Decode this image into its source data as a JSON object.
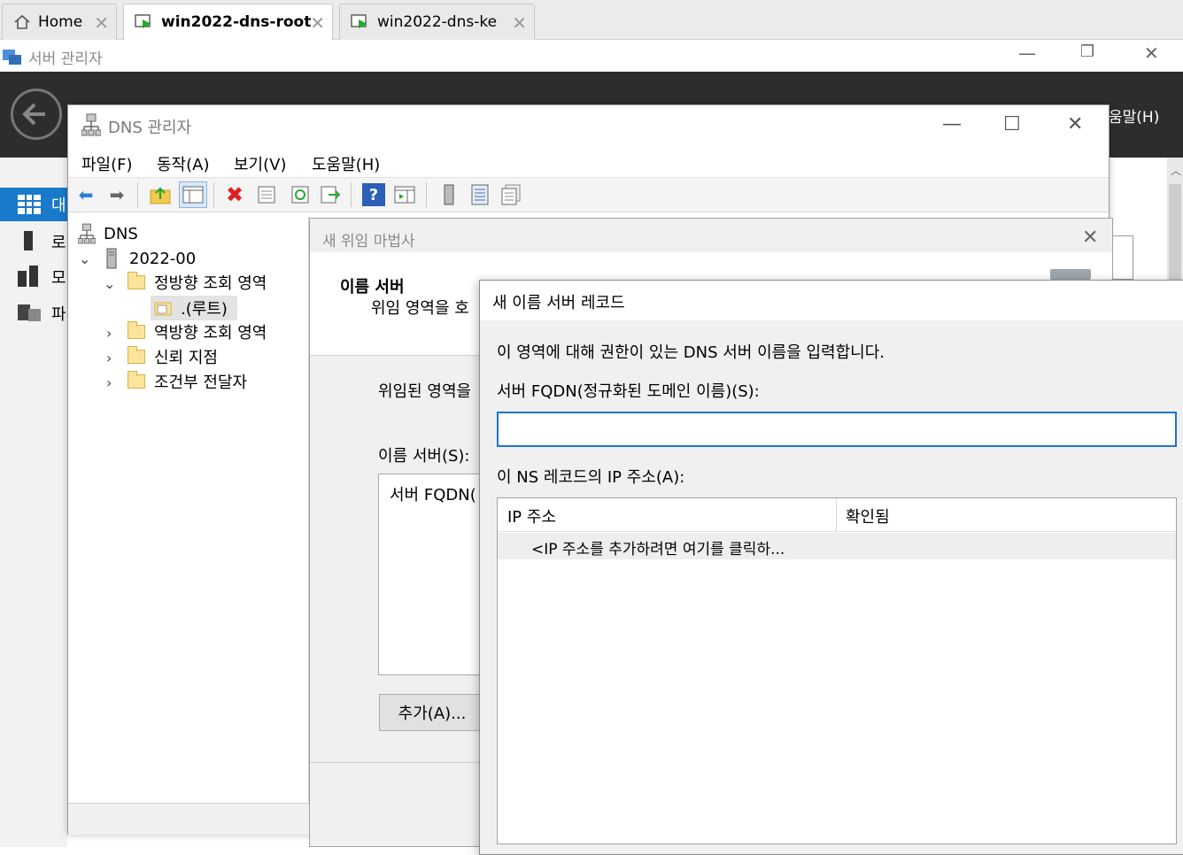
{
  "browser": {
    "tabs": [
      {
        "label": "Home",
        "icon": "home-icon",
        "active": false
      },
      {
        "label": "win2022-dns-root",
        "icon": "vm-icon",
        "active": true
      },
      {
        "label": "win2022-dns-ke",
        "icon": "vm-icon",
        "active": false
      }
    ]
  },
  "server_manager": {
    "title": "서버 관리자",
    "help_menu": "움말(H)",
    "sidebar": [
      {
        "label": "대",
        "icon": "dashboard-icon"
      },
      {
        "label": "로",
        "icon": "local-server-icon"
      },
      {
        "label": "모",
        "icon": "all-servers-icon"
      },
      {
        "label": "파",
        "icon": "file-services-icon"
      }
    ]
  },
  "dns_manager": {
    "title": "DNS 관리자",
    "menu": [
      "파일(F)",
      "동작(A)",
      "보기(V)",
      "도움말(H)"
    ],
    "tree": {
      "root": "DNS",
      "server": "2022-00",
      "forward_zones": "정방향 조회 영역",
      "root_zone": ".(루트)",
      "reverse_zones": "역방향 조회 영역",
      "trust_points": "신뢰 지점",
      "conditional_forwarders": "조건부 전달자"
    }
  },
  "wizard": {
    "title": "새 위임 마법사",
    "header_title": "이름 서버",
    "header_subtitle": "위임 영역을 호",
    "delegated_label": "위임된 영역을",
    "name_servers_label": "이름 서버(S):",
    "list_header": "서버 FQDN(",
    "add_button": "추가(A)..."
  },
  "ns_dialog": {
    "title": "새 이름 서버 레코드",
    "description": "이 영역에 대해 권한이 있는 DNS 서버 이름을 입력합니다.",
    "fqdn_label": "서버 FQDN(정규화된 도메인 이름)(S):",
    "fqdn_value": "",
    "ip_label": "이 NS 레코드의 IP 주소(A):",
    "columns": [
      "IP 주소",
      "확인됨"
    ],
    "add_row_hint": "<IP 주소를 추가하려면 여기를 클릭하..."
  }
}
